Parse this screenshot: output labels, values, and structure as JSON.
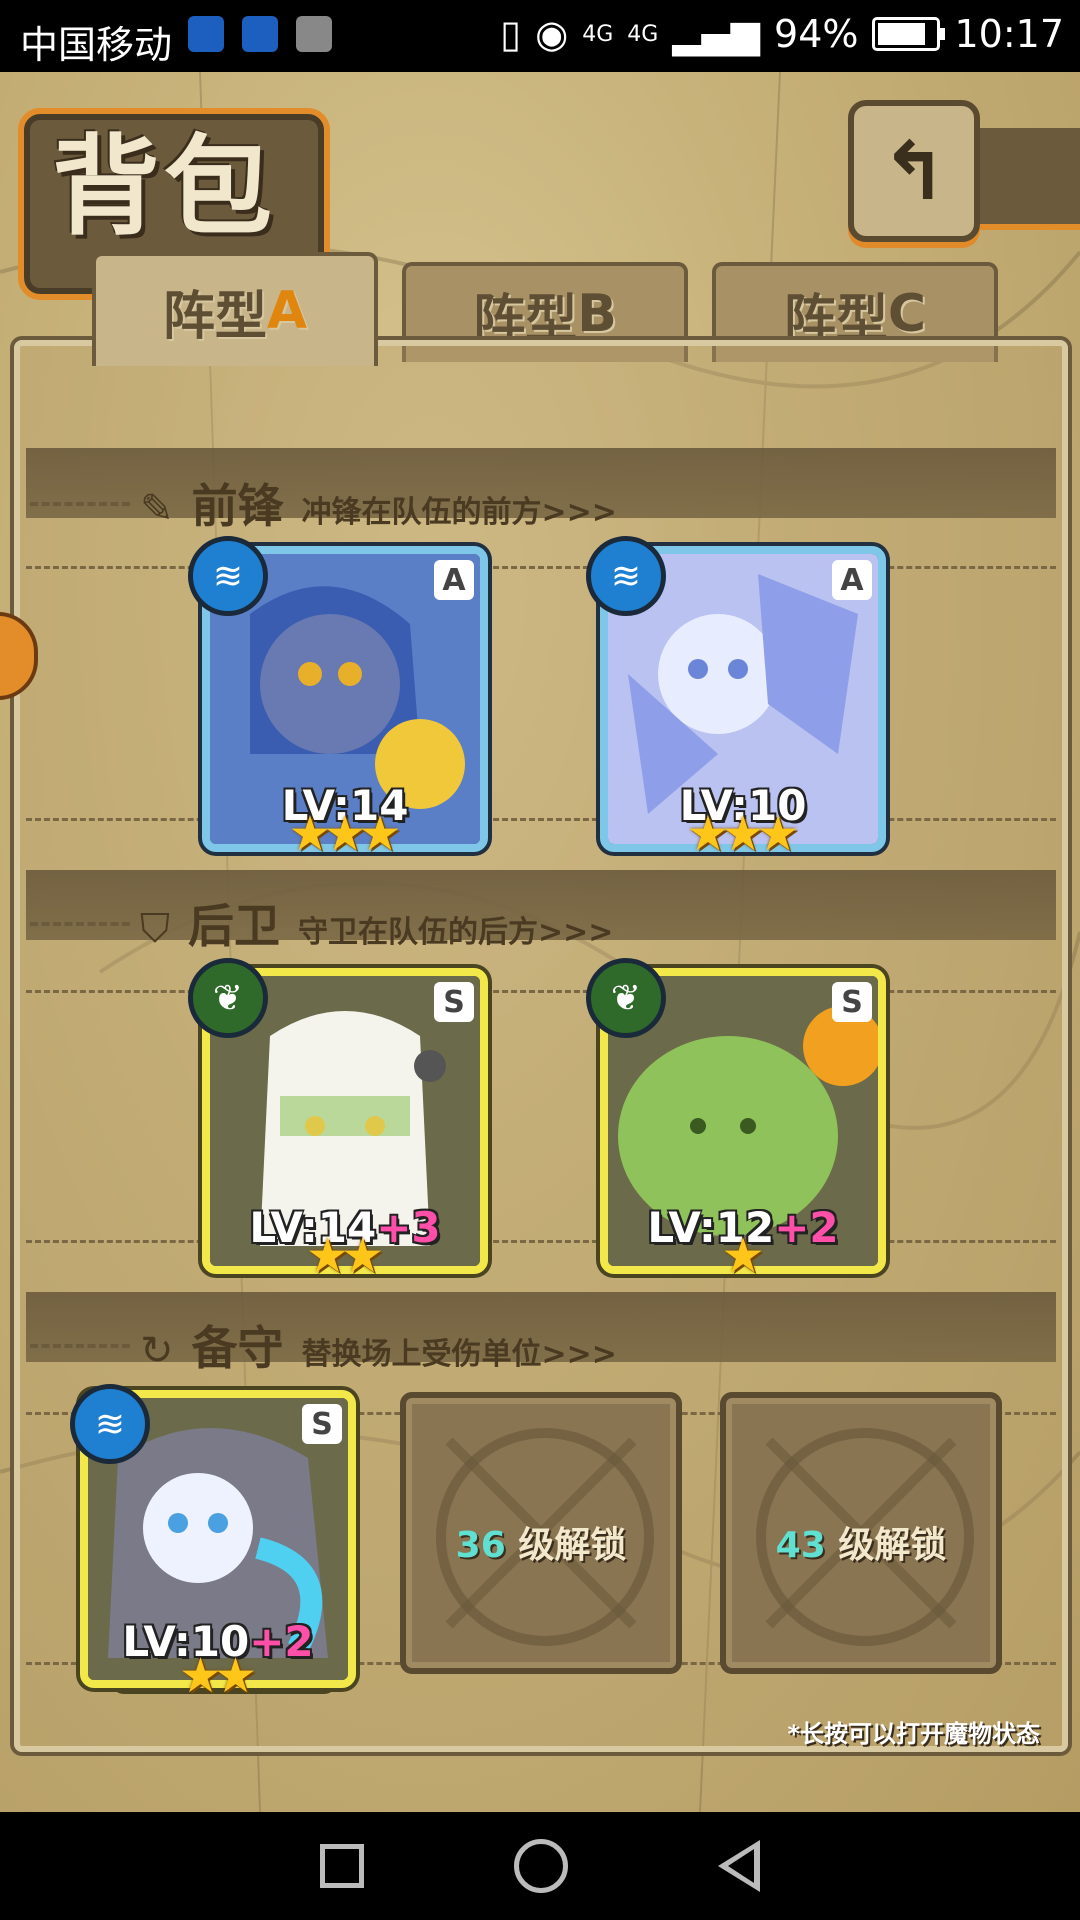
{
  "status_bar": {
    "carrier": "中国移动",
    "network": "4G",
    "network2": "4G",
    "battery": "94%",
    "battery_level": 0.94,
    "time": "10:17"
  },
  "header": {
    "title": "背包",
    "back_icon": "back-arrow-icon"
  },
  "tabs": [
    {
      "label": "阵型",
      "suffix": "A",
      "active": true
    },
    {
      "label": "阵型",
      "suffix": "B",
      "active": false
    },
    {
      "label": "阵型",
      "suffix": "C",
      "active": false
    }
  ],
  "sections": {
    "front": {
      "name": "前锋",
      "desc": "冲锋在队伍的前方>>>",
      "icon": "sword-icon"
    },
    "back": {
      "name": "后卫",
      "desc": "守卫在队伍的后方>>>",
      "icon": "shield-icon"
    },
    "reserve": {
      "name": "备守",
      "desc": "替换场上受伤单位>>>",
      "icon": "swap-icon"
    }
  },
  "front_cards": [
    {
      "rank": "A",
      "element": "water",
      "level": "LV:14",
      "plus": "",
      "stars": 3
    },
    {
      "rank": "A",
      "element": "water",
      "level": "LV:10",
      "plus": "",
      "stars": 3
    }
  ],
  "back_cards": [
    {
      "rank": "S",
      "element": "grass",
      "level": "LV:14",
      "plus": "+3",
      "stars": 2
    },
    {
      "rank": "S",
      "element": "grass",
      "level": "LV:12",
      "plus": "+2",
      "stars": 1
    }
  ],
  "reserve_card": {
    "rank": "S",
    "element": "water",
    "level": "LV:10",
    "plus": "+2",
    "stars": 2
  },
  "locked_slots": [
    {
      "level": "36",
      "text": "级解锁"
    },
    {
      "level": "43",
      "text": "级解锁"
    }
  ],
  "hint": "*长按可以打开魔物状态",
  "colors": {
    "accent_orange": "#e28c2a",
    "rank_a_border": "#7ec7e8",
    "rank_s_border": "#f2e84a",
    "plus_pink": "#ff4fa8",
    "unlock_cyan": "#5fe0d0"
  }
}
